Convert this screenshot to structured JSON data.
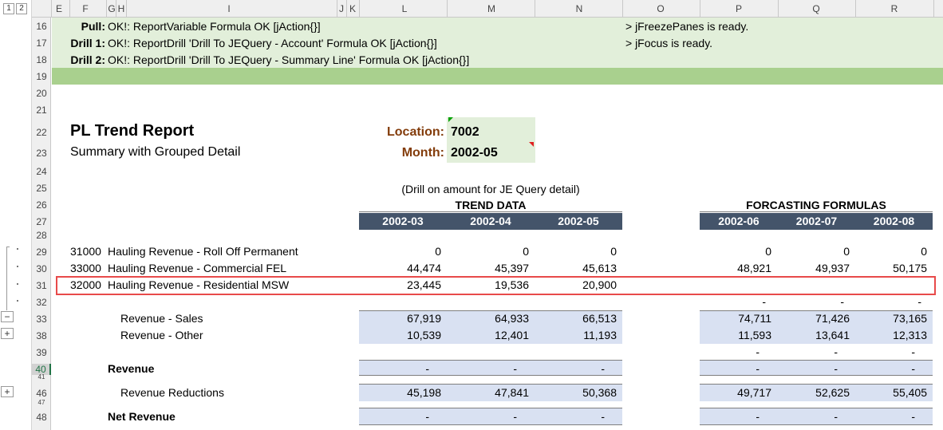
{
  "outline": {
    "level1": "1",
    "level2": "2",
    "expand": "+",
    "collapse": "−"
  },
  "columns": [
    "E",
    "F",
    "G",
    "H",
    "I",
    "J",
    "K",
    "L",
    "M",
    "N",
    "O",
    "P",
    "Q",
    "R"
  ],
  "rows": [
    "16",
    "17",
    "18",
    "19",
    "20",
    "21",
    "22",
    "23",
    "24",
    "25",
    "26",
    "27",
    "28",
    "29",
    "30",
    "31",
    "32",
    "33",
    "38",
    "39",
    "40",
    "41",
    "46",
    "47",
    "48"
  ],
  "status": {
    "pull_label": "Pull:",
    "pull_text": "OK!: ReportVariable Formula OK [jAction{}]",
    "drill1_label": "Drill 1:",
    "drill1_text": "OK!: ReportDrill 'Drill To JEQuery - Account' Formula OK [jAction{}]",
    "drill2_label": "Drill 2:",
    "drill2_text": "OK!: ReportDrill 'Drill To JEQuery - Summary Line' Formula OK [jAction{}]",
    "freeze": "> jFreezePanes is ready.",
    "focus": "> jFocus is ready."
  },
  "report": {
    "title": "PL Trend Report",
    "subtitle": "Summary with Grouped Detail",
    "location_label": "Location:",
    "location_value": "7002",
    "month_label": "Month:",
    "month_value": "2002-05",
    "drill_note": "(Drill on amount for JE Query detail)",
    "trend_header": "TREND DATA",
    "forecast_header": "FORCASTING FORMULAS",
    "periods": [
      "2002-03",
      "2002-04",
      "2002-05",
      "2002-06",
      "2002-07",
      "2002-08"
    ]
  },
  "detail_rows": [
    {
      "account": "31000",
      "name": "Hauling Revenue - Roll Off Permanent",
      "values": [
        "0",
        "0",
        "0",
        "0",
        "0",
        "0"
      ]
    },
    {
      "account": "33000",
      "name": "Hauling Revenue - Commercial FEL",
      "values": [
        "44,474",
        "45,397",
        "45,613",
        "48,921",
        "49,937",
        "50,175"
      ]
    },
    {
      "account": "32000",
      "name": "Hauling Revenue - Residential MSW",
      "values": [
        "23,445",
        "19,536",
        "20,900",
        "",
        "",
        ""
      ]
    }
  ],
  "row32_values": [
    "-",
    "-",
    "-"
  ],
  "summary_rows": [
    {
      "name": "Revenue - Sales",
      "values": [
        "67,919",
        "64,933",
        "66,513",
        "74,711",
        "71,426",
        "73,165"
      ]
    },
    {
      "name": "Revenue - Other",
      "values": [
        "10,539",
        "12,401",
        "11,193",
        "11,593",
        "13,641",
        "12,313"
      ]
    }
  ],
  "row39_values": [
    "-",
    "-",
    "-"
  ],
  "revenue_row": {
    "name": "Revenue",
    "values": [
      "-",
      "-",
      "-",
      "-",
      "-",
      "-"
    ]
  },
  "reductions_row": {
    "name": "Revenue Reductions",
    "values": [
      "45,198",
      "47,841",
      "50,368",
      "49,717",
      "52,625",
      "55,405"
    ]
  },
  "net_row": {
    "name": "Net Revenue",
    "values": [
      "-",
      "-",
      "-",
      "-",
      "-",
      "-"
    ]
  },
  "colors": {
    "green_fill": "#e2efda",
    "green_band": "#a9d08e",
    "header_navy": "#44546a",
    "summary_blue": "#d9e1f2",
    "highlight_red": "#e84a4a",
    "location_brown": "#833c0b"
  }
}
